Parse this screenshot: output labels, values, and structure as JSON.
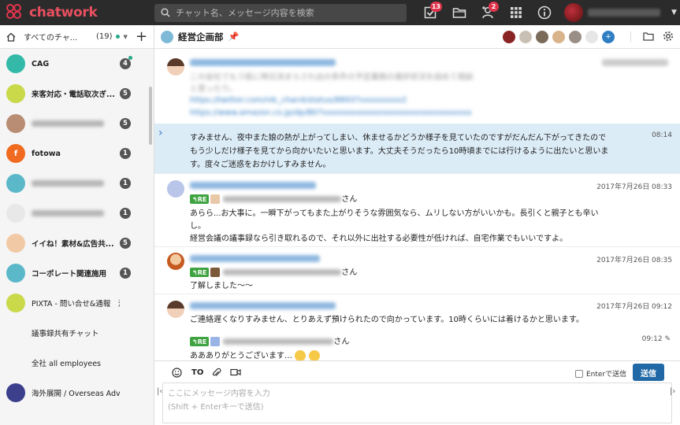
{
  "app": {
    "logo_text": "chatwork",
    "search_placeholder": "チャット名、メッセージ内容を検索",
    "badges": {
      "tasks": "13",
      "contacts": "2"
    }
  },
  "sidebar": {
    "filter_label": "すべてのチャ...",
    "filter_count": "(19)",
    "rooms": [
      {
        "name": "CAG",
        "badge": "4",
        "bold": true,
        "avatar_color": "#34b9a9",
        "avatar_text": "",
        "dot": true
      },
      {
        "name": "来客対応・電話取次ぎ...",
        "badge": "5",
        "bold": true,
        "avatar_color": "#c9d94a",
        "avatar_text": ""
      },
      {
        "name": "",
        "badge": "5",
        "bold": true,
        "avatar_color": "#b98d73",
        "avatar_text": "",
        "blur": true
      },
      {
        "name": "fotowa",
        "badge": "1",
        "bold": true,
        "avatar_color": "#f06a1f",
        "avatar_text": "f"
      },
      {
        "name": "",
        "badge": "1",
        "bold": true,
        "avatar_color": "#5bb8c9",
        "avatar_text": "",
        "blur": true
      },
      {
        "name": "",
        "badge": "1",
        "bold": true,
        "avatar_color": "#e8e8e8",
        "avatar_text": "",
        "blur": true
      },
      {
        "name": "イイね！素材&広告共...",
        "badge": "5",
        "bold": true,
        "avatar_color": "#f2c9a5",
        "avatar_text": ""
      },
      {
        "name": "コーポレート関連施用",
        "badge": "1",
        "bold": true,
        "avatar_color": "#5bb8c9",
        "avatar_text": ""
      },
      {
        "name": "PIXTA - 問い合せ&通報　法...",
        "badge": "",
        "bold": false,
        "avatar_color": "#c9d94a",
        "avatar_text": ""
      },
      {
        "name": "議事録共有チャット",
        "badge": "",
        "bold": false,
        "avatar_color": "#f5f5f5",
        "avatar_text": ""
      },
      {
        "name": "全社 all employees",
        "badge": "",
        "bold": false,
        "avatar_color": "#f5f5f5",
        "avatar_text": ""
      },
      {
        "name": "海外展開 / Overseas Advance",
        "badge": "",
        "bold": false,
        "avatar_color": "#3b3f8c",
        "avatar_text": ""
      }
    ]
  },
  "room": {
    "title": "経営企画部",
    "member_more": "+"
  },
  "messages": [
    {
      "date": "",
      "lines": [],
      "blurred_lines": 2,
      "link_lines": 2
    },
    {
      "time": "08:14",
      "lines": [
        "すみません、夜中また娘の熱が上がってしまい、休ませるかどうか様子を見ていたのですがだんだん下がってきたので",
        "もう少しだけ様子を見てから向かいたいと思います。大丈夫そうだったら10時頃までには行けるように出たいと思いま",
        "す。度々ご迷惑をおかけしすみません。"
      ]
    },
    {
      "date": "2017年7月26日 08:33",
      "re_label": "RE",
      "re_suffix": "さん",
      "lines": [
        "あらら...お大事に。一瞬下がってもまた上がりそうな雰囲気なら、ムリしない方がいいかも。長引くと親子とも辛い",
        "し。",
        "経営会議の議事録なら引き取れるので、それ以外に出社する必要性が低ければ、自宅作業でもいいですよ。"
      ]
    },
    {
      "date": "2017年7月26日 08:35",
      "re_label": "RE",
      "re_suffix": "さん",
      "lines": [
        "了解しました〜〜"
      ]
    },
    {
      "date": "2017年7月26日 09:12",
      "lines": [
        "ご連絡遅くなりすみません、とりあえず預けられたので向かっています。10時くらいには着けるかと思います。"
      ]
    },
    {
      "time": "09:12",
      "re_label": "RE",
      "re_suffix": "さん",
      "lines": [
        "ああありがとうございます…"
      ]
    }
  ],
  "compose": {
    "to_label": "TO",
    "enter_label": "Enterで送信",
    "send_label": "送信",
    "placeholder_line1": "ここにメッセージ内容を入力",
    "placeholder_line2": "(Shift + Enterキーで送信)"
  }
}
